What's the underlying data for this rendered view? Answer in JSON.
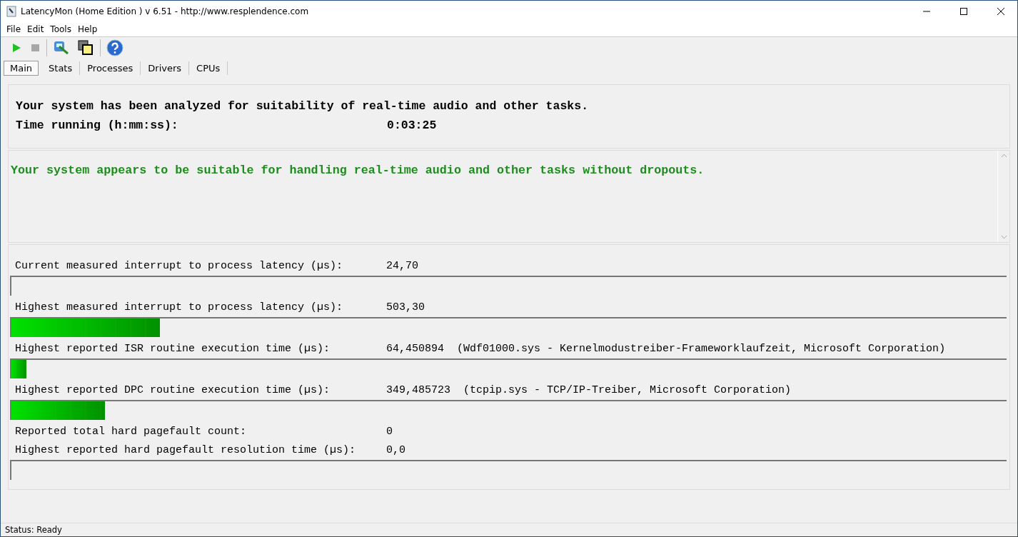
{
  "window": {
    "title": "LatencyMon  (Home Edition )  v 6.51 - http://www.resplendence.com"
  },
  "menu": [
    "File",
    "Edit",
    "Tools",
    "Help"
  ],
  "tabs": [
    {
      "label": "Main",
      "selected": true
    },
    {
      "label": "Stats",
      "selected": false
    },
    {
      "label": "Processes",
      "selected": false
    },
    {
      "label": "Drivers",
      "selected": false
    },
    {
      "label": "CPUs",
      "selected": false
    }
  ],
  "summary": {
    "headline": "Your system has been analyzed for suitability of real-time audio and other tasks.",
    "time_label": "Time running (h:mm:ss):",
    "time_value": "0:03:25"
  },
  "verdict": "Your system appears to be suitable for handling real-time audio and other tasks without dropouts.",
  "metrics": [
    {
      "kind": "reading",
      "label": "Current measured interrupt to process latency (µs):",
      "value": "24,70"
    },
    {
      "kind": "meter",
      "level": 0
    },
    {
      "kind": "reading",
      "label": "Highest measured interrupt to process latency (µs):",
      "value": "503,30"
    },
    {
      "kind": "meter",
      "level": 0.149
    },
    {
      "kind": "reading",
      "label": "Highest reported ISR routine execution time (µs):",
      "value": "64,450894",
      "detail": "(Wdf01000.sys - Kernelmodustreiber-Frameworklaufzeit, Microsoft Corporation)"
    },
    {
      "kind": "meter",
      "level": 0.015
    },
    {
      "kind": "reading",
      "label": "Highest reported DPC routine execution time (µs):",
      "value": "349,485723",
      "detail": "(tcpip.sys - TCP/IP-Treiber, Microsoft Corporation)"
    },
    {
      "kind": "meter",
      "level": 0.094
    },
    {
      "kind": "reading",
      "label": "Reported total hard pagefault count:",
      "value": "0"
    },
    {
      "kind": "reading",
      "label": "Highest reported hard pagefault resolution time (µs):",
      "value": "0,0"
    },
    {
      "kind": "meter",
      "level": 0
    }
  ],
  "status_bar": "Status: Ready"
}
